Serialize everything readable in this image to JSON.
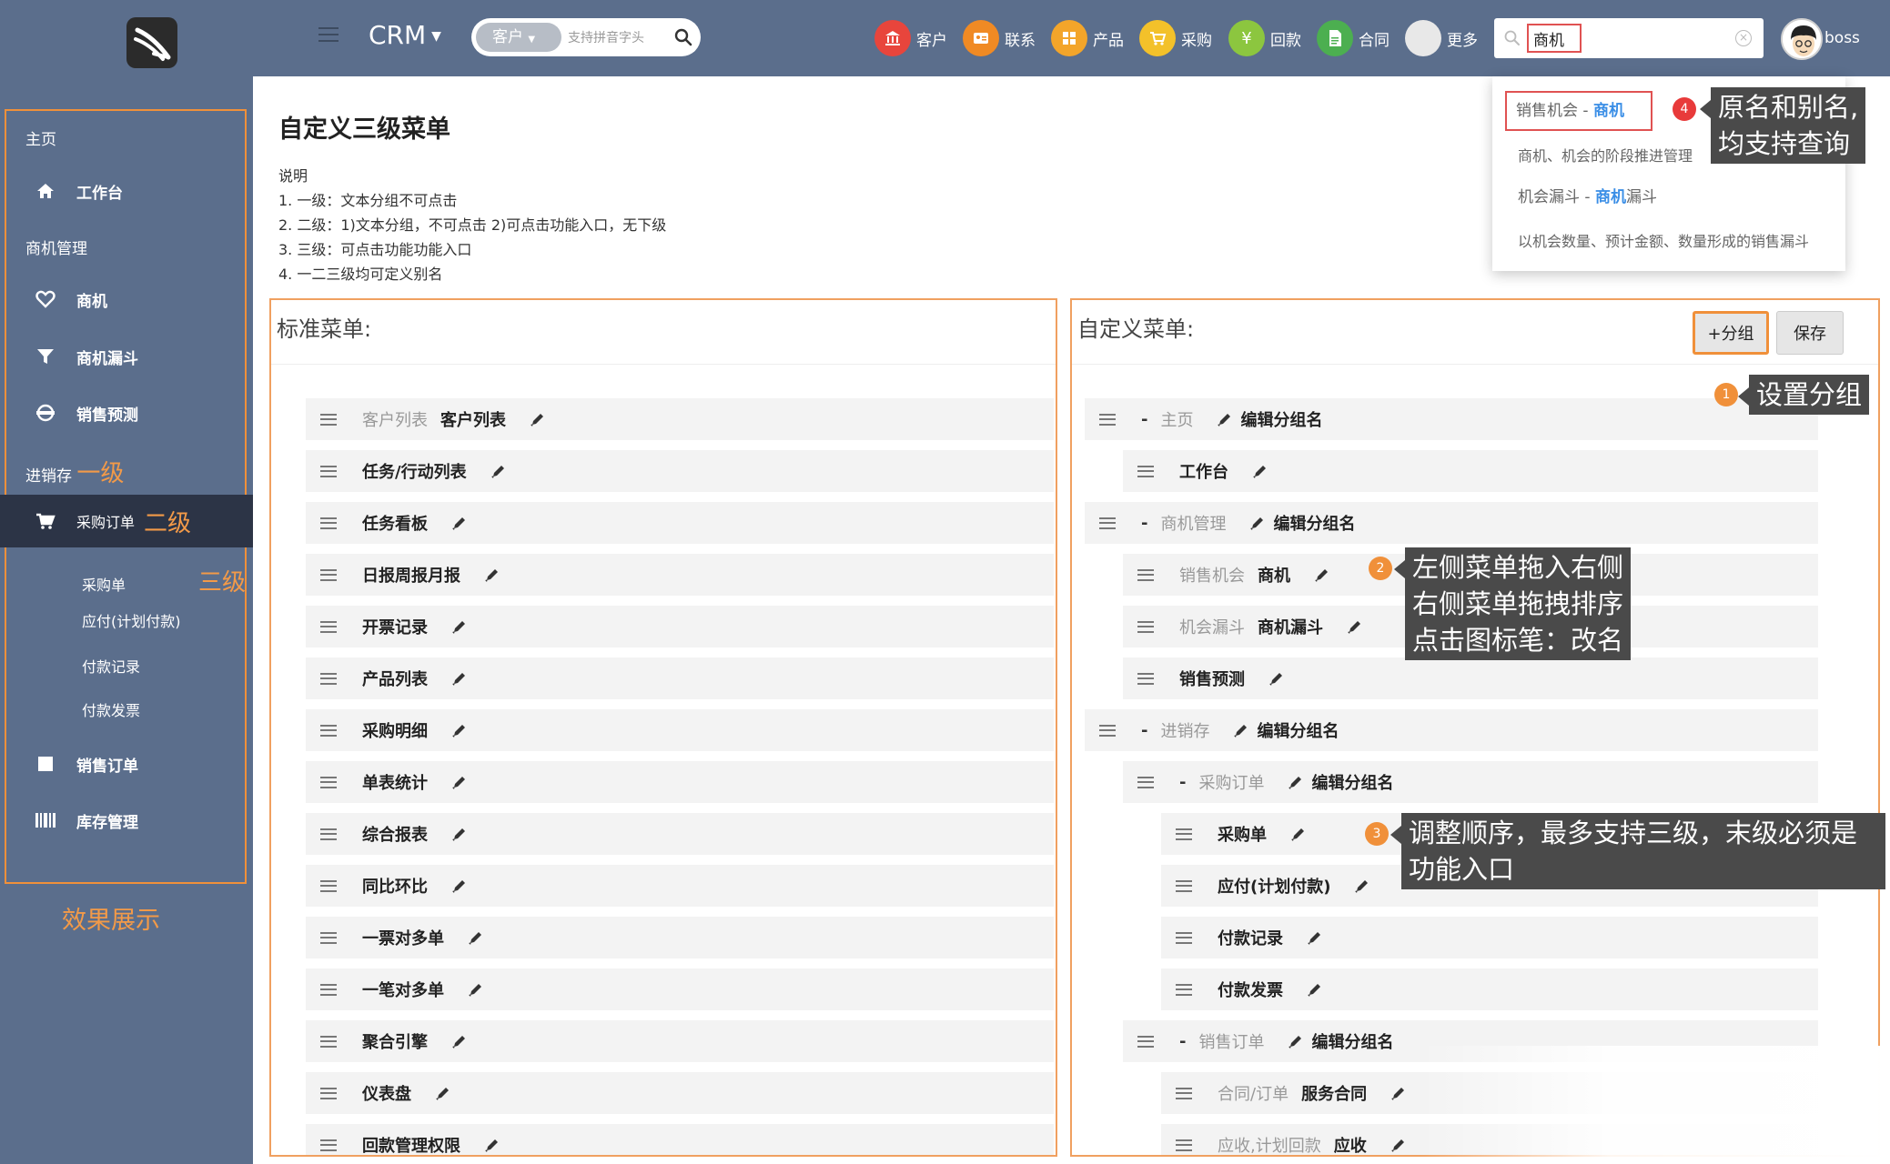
{
  "header": {
    "app_name": "CRM",
    "search_select": "客户",
    "search_placeholder": "支持拼音字头",
    "nav": [
      {
        "label": "客户",
        "icon": "bank-icon",
        "color": "#e8453c"
      },
      {
        "label": "联系",
        "icon": "contact-card-icon",
        "color": "#f08a24"
      },
      {
        "label": "产品",
        "icon": "grid-icon",
        "color": "#f3a52a"
      },
      {
        "label": "采购",
        "icon": "cart-icon",
        "color": "#f3c12a"
      },
      {
        "label": "回款",
        "icon": "yen-icon",
        "color": "#8cc63f"
      },
      {
        "label": "合同",
        "icon": "document-icon",
        "color": "#4caf50"
      },
      {
        "label": "更多",
        "icon": "more-icon",
        "color": "#e8e8e8"
      }
    ],
    "global_search_value": "商机",
    "user_name": "boss"
  },
  "sidebar": {
    "sections": [
      {
        "label": "主页"
      },
      {
        "label": "商机管理"
      },
      {
        "label": "进销存",
        "level_tag": "一级"
      }
    ],
    "items": [
      {
        "label": "工作台",
        "icon": "home-icon"
      },
      {
        "label": "商机",
        "icon": "heart-icon"
      },
      {
        "label": "商机漏斗",
        "icon": "funnel-icon"
      },
      {
        "label": "销售预测",
        "icon": "forecast-icon"
      },
      {
        "label": "采购订单",
        "icon": "cart-icon",
        "level_tag": "二级"
      },
      {
        "label": "销售订单",
        "icon": "square-icon"
      },
      {
        "label": "库存管理",
        "icon": "barcode-icon"
      }
    ],
    "sub_items": [
      {
        "label": "采购单",
        "level_tag": "三级"
      },
      {
        "label": "应付(计划付款)"
      },
      {
        "label": "付款记录"
      },
      {
        "label": "付款发票"
      }
    ],
    "effect_label": "效果展示"
  },
  "main": {
    "title": "自定义三级菜单",
    "notes": [
      "说明",
      "1. 一级：文本分组不可点击",
      "2. 二级：1)文本分组，不可点击 2)可点击功能入口，无下级",
      "3. 三级：可点击功能功能入口",
      "4. 一二三级均可定义别名"
    ]
  },
  "standard_menu": {
    "title": "标准菜单:",
    "items": [
      {
        "original": "客户列表",
        "name": "客户列表"
      },
      {
        "original": "",
        "name": "任务/行动列表"
      },
      {
        "original": "",
        "name": "任务看板"
      },
      {
        "original": "",
        "name": "日报周报月报"
      },
      {
        "original": "",
        "name": "开票记录"
      },
      {
        "original": "",
        "name": "产品列表"
      },
      {
        "original": "",
        "name": "采购明细"
      },
      {
        "original": "",
        "name": "单表统计"
      },
      {
        "original": "",
        "name": "综合报表"
      },
      {
        "original": "",
        "name": "同比环比"
      },
      {
        "original": "",
        "name": "一票对多单"
      },
      {
        "original": "",
        "name": "一笔对多单"
      },
      {
        "original": "",
        "name": "聚合引擎"
      },
      {
        "original": "",
        "name": "仪表盘"
      },
      {
        "original": "",
        "name": "回款管理权限"
      }
    ]
  },
  "custom_menu": {
    "title": "自定义菜单:",
    "add_group_label": "+分组",
    "save_label": "保存",
    "edit_group_label": "编辑分组名",
    "rows": [
      {
        "type": "group",
        "level": 1,
        "name": "主页"
      },
      {
        "type": "item",
        "level": 2,
        "original": "",
        "name": "工作台"
      },
      {
        "type": "group",
        "level": 1,
        "name": "商机管理"
      },
      {
        "type": "item",
        "level": 2,
        "original": "销售机会",
        "name": "商机"
      },
      {
        "type": "item",
        "level": 2,
        "original": "机会漏斗",
        "name": "商机漏斗"
      },
      {
        "type": "item",
        "level": 2,
        "original": "",
        "name": "销售预测"
      },
      {
        "type": "group",
        "level": 1,
        "name": "进销存"
      },
      {
        "type": "group",
        "level": 2,
        "name": "采购订单"
      },
      {
        "type": "item",
        "level": 3,
        "original": "",
        "name": "采购单"
      },
      {
        "type": "item",
        "level": 3,
        "original": "",
        "name": "应付(计划付款)"
      },
      {
        "type": "item",
        "level": 3,
        "original": "",
        "name": "付款记录"
      },
      {
        "type": "item",
        "level": 3,
        "original": "",
        "name": "付款发票"
      },
      {
        "type": "group",
        "level": 2,
        "name": "销售订单"
      },
      {
        "type": "item",
        "level": 3,
        "original": "合同/订单",
        "name": "服务合同"
      },
      {
        "type": "item",
        "level": 3,
        "original": "应收,计划回款",
        "name": "应收"
      }
    ]
  },
  "search_dropdown": {
    "results": [
      {
        "title_prefix": "销售机会 - ",
        "title_highlight": "商机",
        "title_suffix": "",
        "desc": "商机、机会的阶段推进管理"
      },
      {
        "title_prefix": "机会漏斗 - ",
        "title_highlight": "商机",
        "title_suffix": "漏斗",
        "desc": "以机会数量、预计金额、数量形成的销售漏斗"
      }
    ]
  },
  "callouts": [
    {
      "num": "1",
      "text": "设置分组"
    },
    {
      "num": "2",
      "lines": [
        "左侧菜单拖入右侧",
        "右侧菜单拖拽排序",
        "点击图标笔：改名"
      ]
    },
    {
      "num": "3",
      "lines": [
        "调整顺序，最多支持三级，末级必须是",
        "功能入口"
      ]
    },
    {
      "num": "4",
      "lines": [
        "原名和别名,",
        "均支持查询"
      ]
    }
  ]
}
